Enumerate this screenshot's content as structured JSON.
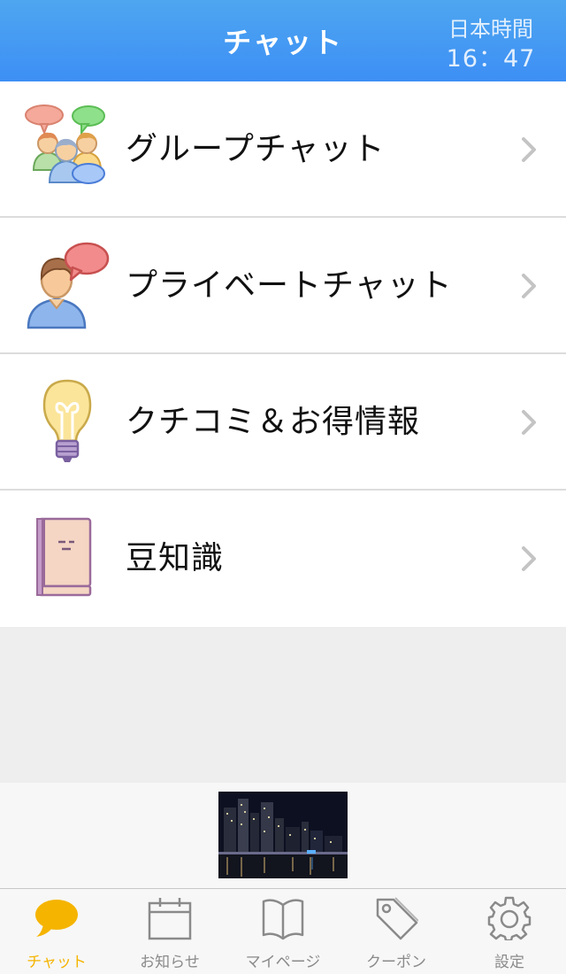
{
  "header": {
    "title": "チャット",
    "clock_label": "日本時間",
    "clock_time": "16：47"
  },
  "menu": {
    "items": [
      {
        "label": "グループチャット",
        "icon": "group-chat-icon"
      },
      {
        "label": "プライベートチャット",
        "icon": "private-chat-icon"
      },
      {
        "label": "クチコミ＆お得情報",
        "icon": "lightbulb-icon"
      },
      {
        "label": "豆知識",
        "icon": "notebook-icon"
      }
    ]
  },
  "banner": {
    "image": "night-city-skyline-photo"
  },
  "tabbar": {
    "active_color": "#f5b400",
    "inactive_color": "#8a8a8a",
    "tabs": [
      {
        "label": "チャット",
        "icon": "chat-bubble-icon",
        "active": true
      },
      {
        "label": "お知らせ",
        "icon": "calendar-icon",
        "active": false
      },
      {
        "label": "マイページ",
        "icon": "book-icon",
        "active": false
      },
      {
        "label": "クーポン",
        "icon": "tag-icon",
        "active": false
      },
      {
        "label": "設定",
        "icon": "gear-icon",
        "active": false
      }
    ]
  },
  "colors": {
    "header_gradient_top": "#4ea6f0",
    "header_gradient_bottom": "#3d8ff5",
    "background": "#eeeeee"
  }
}
